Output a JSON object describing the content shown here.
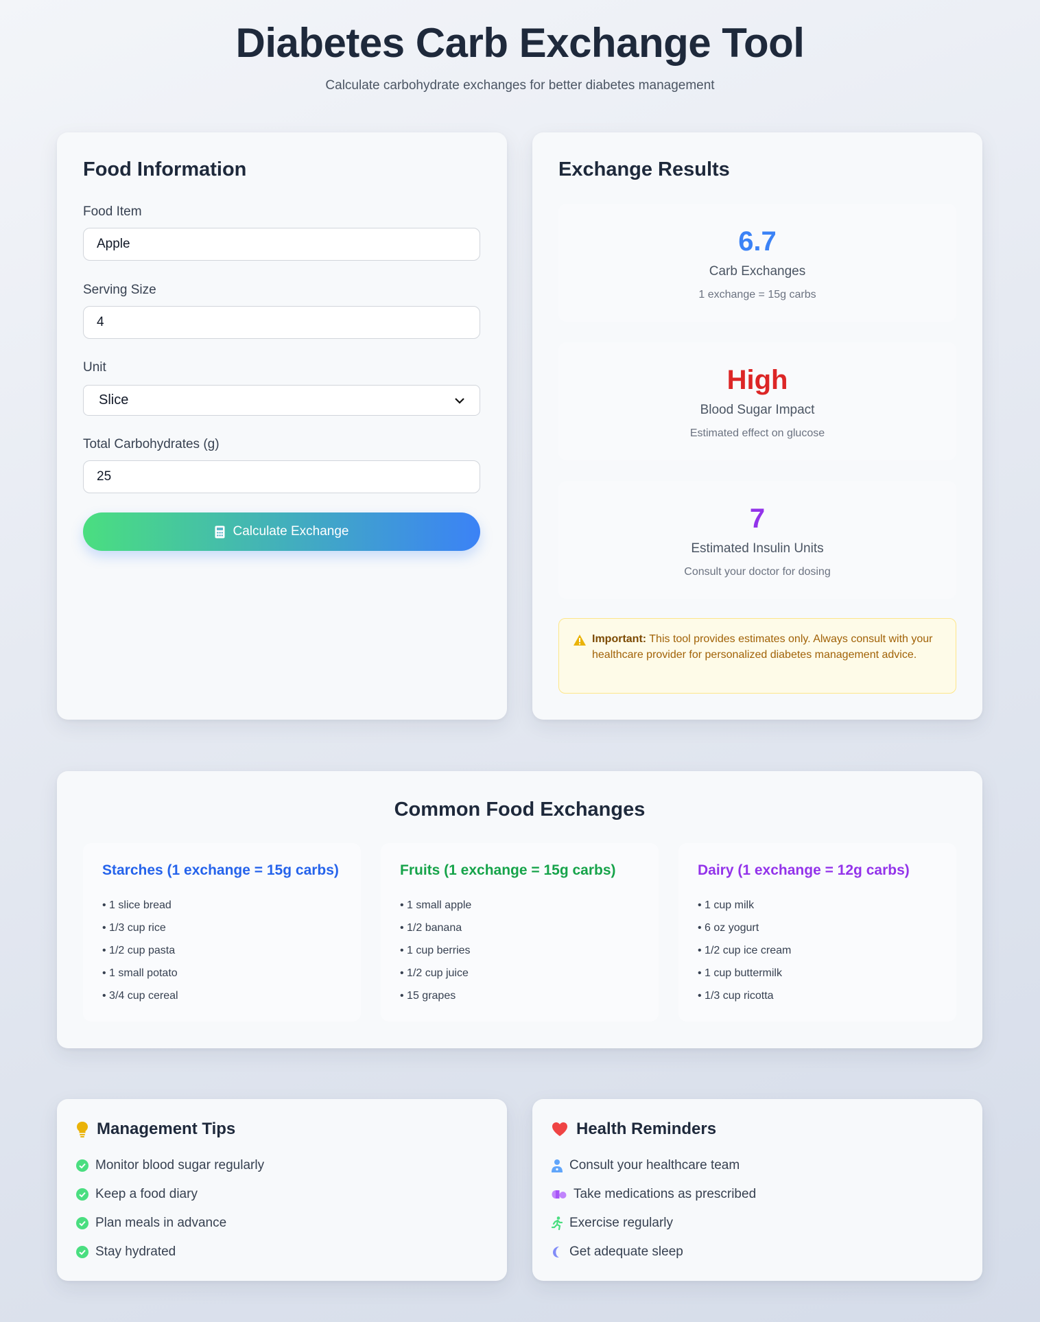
{
  "header": {
    "title": "Diabetes Carb Exchange Tool",
    "subtitle": "Calculate carbohydrate exchanges for better diabetes management"
  },
  "food_form": {
    "title": "Food Information",
    "food_item_label": "Food Item",
    "food_item_value": "Apple",
    "serving_size_label": "Serving Size",
    "serving_size_value": "4",
    "unit_label": "Unit",
    "unit_value": "Slice",
    "carbs_label": "Total Carbohydrates (g)",
    "carbs_value": "25",
    "calculate_button": "Calculate Exchange"
  },
  "results": {
    "title": "Exchange Results",
    "carb_exchanges": {
      "value": "6.7",
      "label": "Carb Exchanges",
      "note": "1 exchange = 15g carbs",
      "color": "#3b82f6"
    },
    "blood_sugar": {
      "value": "High",
      "label": "Blood Sugar Impact",
      "note": "Estimated effect on glucose",
      "color": "#dc2626"
    },
    "insulin": {
      "value": "7",
      "label": "Estimated Insulin Units",
      "note": "Consult your doctor for dosing",
      "color": "#9333ea"
    },
    "warning_bold": "Important:",
    "warning_text": " This tool provides estimates only. Always consult with your healthcare provider for personalized diabetes management advice."
  },
  "exchanges": {
    "title": "Common Food Exchanges",
    "columns": [
      {
        "title": "Starches (1 exchange = 15g carbs)",
        "color": "#2563eb",
        "items": [
          "• 1 slice bread",
          "• 1/3 cup rice",
          "• 1/2 cup pasta",
          "• 1 small potato",
          "• 3/4 cup cereal"
        ]
      },
      {
        "title": "Fruits (1 exchange = 15g carbs)",
        "color": "#16a34a",
        "items": [
          "• 1 small apple",
          "• 1/2 banana",
          "• 1 cup berries",
          "• 1/2 cup juice",
          "• 15 grapes"
        ]
      },
      {
        "title": "Dairy (1 exchange = 12g carbs)",
        "color": "#9333ea",
        "items": [
          "• 1 cup milk",
          "• 6 oz yogurt",
          "• 1/2 cup ice cream",
          "• 1 cup buttermilk",
          "• 1/3 cup ricotta"
        ]
      }
    ]
  },
  "tips": {
    "title": "Management Tips",
    "icon": "lightbulb-icon",
    "items": [
      "Monitor blood sugar regularly",
      "Keep a food diary",
      "Plan meals in advance",
      "Stay hydrated"
    ]
  },
  "reminders": {
    "title": "Health Reminders",
    "icon": "heart-icon",
    "items": [
      {
        "icon": "doctor-icon",
        "text": "Consult your healthcare team"
      },
      {
        "icon": "pills-icon",
        "text": "Take medications as prescribed"
      },
      {
        "icon": "running-icon",
        "text": "Exercise regularly"
      },
      {
        "icon": "moon-icon",
        "text": "Get adequate sleep"
      }
    ]
  }
}
